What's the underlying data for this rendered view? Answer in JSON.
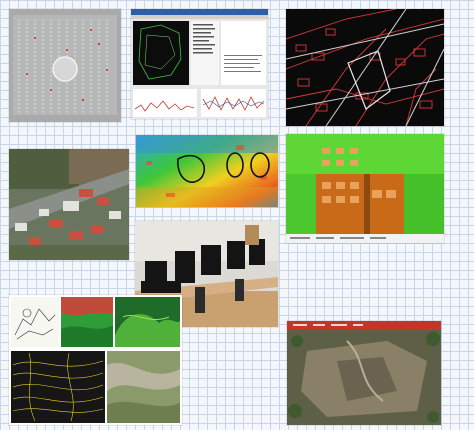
{
  "collage": {
    "description_hidden": "",
    "tiles": [
      {
        "name": "drone-flight-plan-tile"
      },
      {
        "name": "software-screenshot-tile"
      },
      {
        "name": "street-vector-map-tile"
      },
      {
        "name": "oblique-aerial-photo-tile"
      },
      {
        "name": "colorized-point-cloud-tile"
      },
      {
        "name": "classified-orthophoto-tile"
      },
      {
        "name": "computer-workstations-photo-tile"
      },
      {
        "name": "terrain-model-collage-tile"
      },
      {
        "name": "site-orthomosaic-tile"
      }
    ]
  },
  "colors": {
    "background": "#f4f7fc",
    "grid": "#c9d6ea",
    "accent_red": "#e0302a",
    "accent_green": "#3fc63a",
    "accent_orange": "#e8892a"
  }
}
